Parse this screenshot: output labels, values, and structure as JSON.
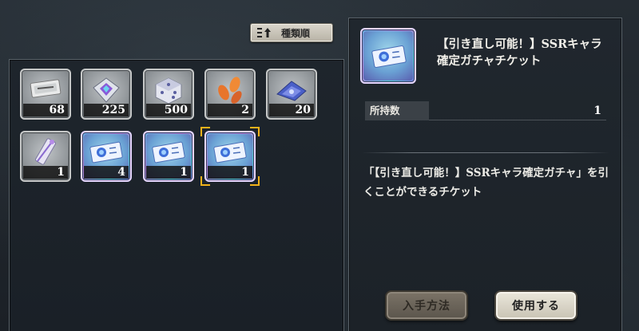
{
  "sort": {
    "label": "種類順",
    "icon": "sort-icon"
  },
  "inventory": {
    "items": [
      {
        "count": "68",
        "icon": "silver-ticket-icon",
        "rare": false
      },
      {
        "count": "225",
        "icon": "crystal-gem-icon",
        "rare": false
      },
      {
        "count": "500",
        "icon": "dice-cube-icon",
        "rare": false
      },
      {
        "count": "2",
        "icon": "orange-leaves-icon",
        "rare": false
      },
      {
        "count": "20",
        "icon": "blue-paper-icon",
        "rare": false
      },
      {
        "count": "1",
        "icon": "bookmark-charm-icon",
        "rare": false
      },
      {
        "count": "4",
        "icon": "gacha-ticket-icon",
        "rare": true
      },
      {
        "count": "1",
        "icon": "gacha-ticket-icon",
        "rare": true
      },
      {
        "count": "1",
        "icon": "gacha-ticket-icon",
        "rare": true,
        "selected": true
      }
    ]
  },
  "detail": {
    "title": "【引き直し可能！】SSRキャラ確定ガチャチケット",
    "owned_label": "所持数",
    "owned_value": "1",
    "description": "「【引き直し可能！】SSRキャラ確定ガチャ」を引くことができるチケット",
    "acquire_label": "入手方法",
    "use_label": "使用する",
    "icon": "gacha-ticket-icon"
  },
  "colors": {
    "selection": "#f2b21b",
    "rare_frame": "#b77ad8",
    "panel_bg": "#1e252c"
  }
}
